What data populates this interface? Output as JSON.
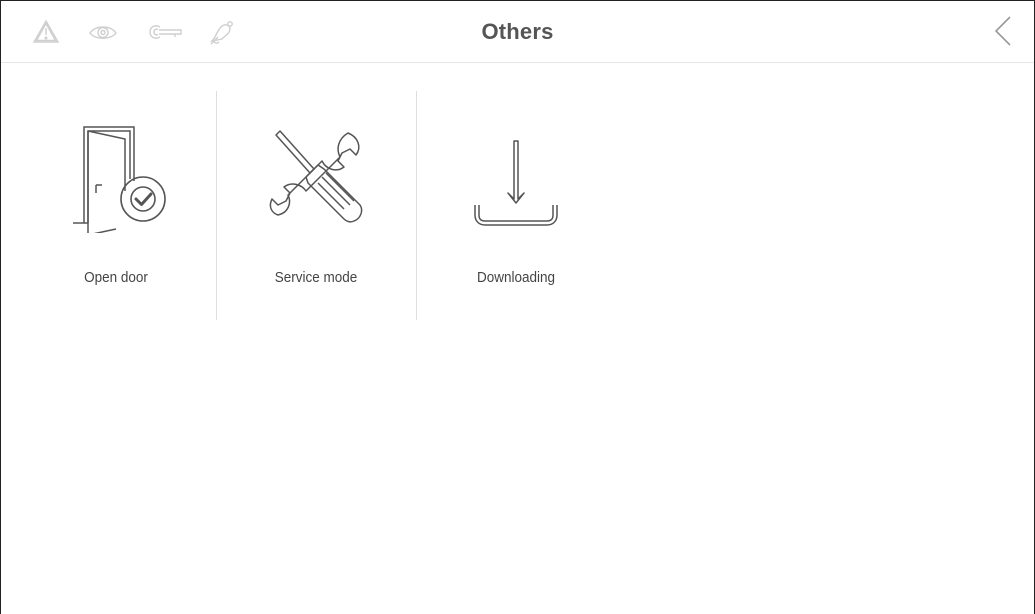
{
  "header": {
    "title": "Others",
    "status_icons": [
      "warning-icon",
      "eye-icon",
      "key-icon",
      "bell-off-icon"
    ],
    "back_icon": "chevron-left-icon"
  },
  "tiles": [
    {
      "label": "Open door",
      "icon": "door-check-icon"
    },
    {
      "label": "Service mode",
      "icon": "tools-icon"
    },
    {
      "label": "Downloading",
      "icon": "download-icon"
    }
  ],
  "colors": {
    "title": "#555555",
    "icon_stroke": "#555555",
    "status_icon": "#d0d0d0",
    "divider": "#dedede"
  }
}
